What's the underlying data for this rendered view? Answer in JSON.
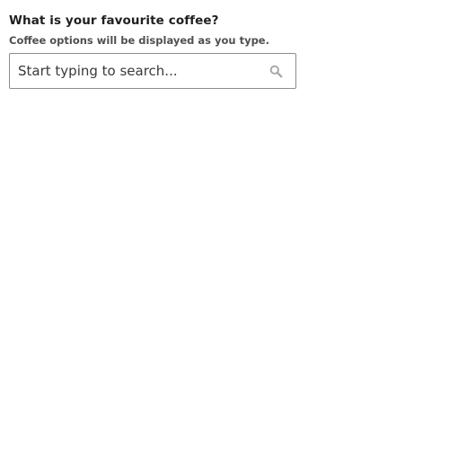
{
  "question": {
    "label": "What is your favourite coffee?",
    "hint": "Coffee options will be displayed as you type."
  },
  "search": {
    "value": "",
    "placeholder": "Start typing to search...",
    "icon": "search-icon"
  },
  "colors": {
    "label_text": "#1f1f1f",
    "hint_text": "#505050",
    "border": "#8c8c8c",
    "icon": "#a6a6a6"
  }
}
